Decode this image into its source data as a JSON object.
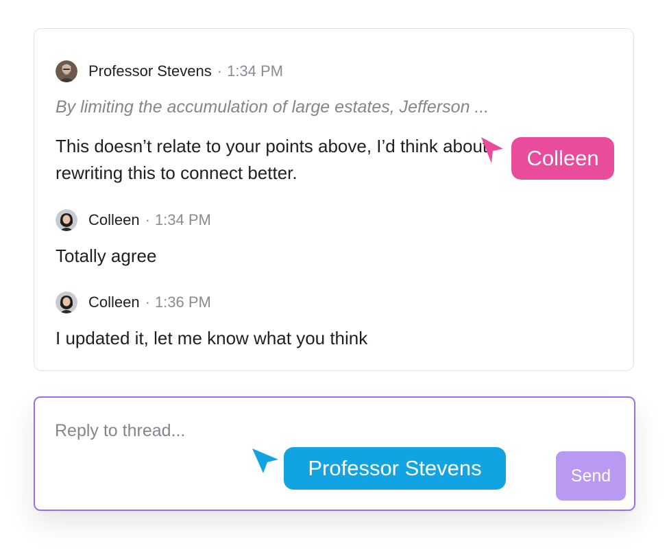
{
  "thread": {
    "quote": "By limiting the accumulation of large estates, Jefferson ...",
    "comments": [
      {
        "author": "Professor Stevens",
        "separator": "·",
        "time": "1:34 PM",
        "body": "This doesn’t relate to your points above, I’d think about\nrewriting this to connect better."
      },
      {
        "author": "Colleen",
        "separator": "·",
        "time": "1:34 PM",
        "body": "Totally agree"
      },
      {
        "author": "Colleen",
        "separator": "·",
        "time": "1:36 PM",
        "body": "I updated it, let me know what you think"
      }
    ]
  },
  "reply": {
    "placeholder": "Reply to thread...",
    "value": "",
    "send_label": "Send"
  },
  "cursors": [
    {
      "name": "Colleen",
      "color": "#ea4c9c",
      "icon": "cursor-arrow-icon"
    },
    {
      "name": "Professor Stevens",
      "color": "#12a3e3",
      "icon": "cursor-arrow-icon"
    }
  ],
  "colors": {
    "accent": "#9b6df0",
    "send_button": "#b89af2",
    "text": "#1f1f23",
    "muted": "#85858d"
  }
}
